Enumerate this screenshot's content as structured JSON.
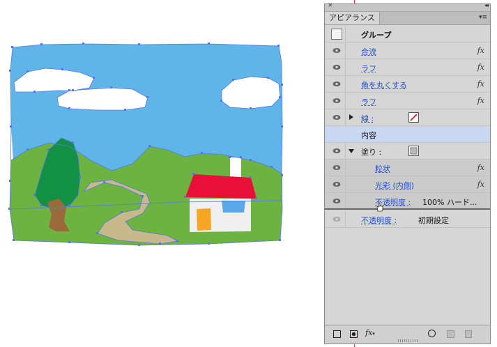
{
  "panel": {
    "close_glyph": "×",
    "collapse_glyph": "◂◂",
    "tab_label": "アピアランス",
    "menu_glyph": "▾≡",
    "group_label": "グループ",
    "rows": [
      {
        "label": "合流",
        "fx": "fx"
      },
      {
        "label": "ラフ",
        "fx": "fx"
      },
      {
        "label": "角を丸くする",
        "fx": "fx"
      },
      {
        "label": "ラフ",
        "fx": "fx"
      }
    ],
    "stroke_label": "線 :",
    "contents_label": "内容",
    "fill_label": "塗り :",
    "fill_children": [
      {
        "label": "粒状",
        "fx": "fx"
      },
      {
        "label": "光彩 (内側)",
        "fx": "fx"
      },
      {
        "label": "不透明度 :",
        "value": "100% ハード..."
      }
    ],
    "opacity_label": "不透明度 :",
    "opacity_value": "初期設定",
    "bottom": {
      "fx_label": "fx",
      "fx_arrow": "▾"
    },
    "colors": {
      "link": "#1f4fd1",
      "selected_row": "#c9d7f2",
      "stroke_swatch_slash": "#cc1a2a"
    }
  }
}
